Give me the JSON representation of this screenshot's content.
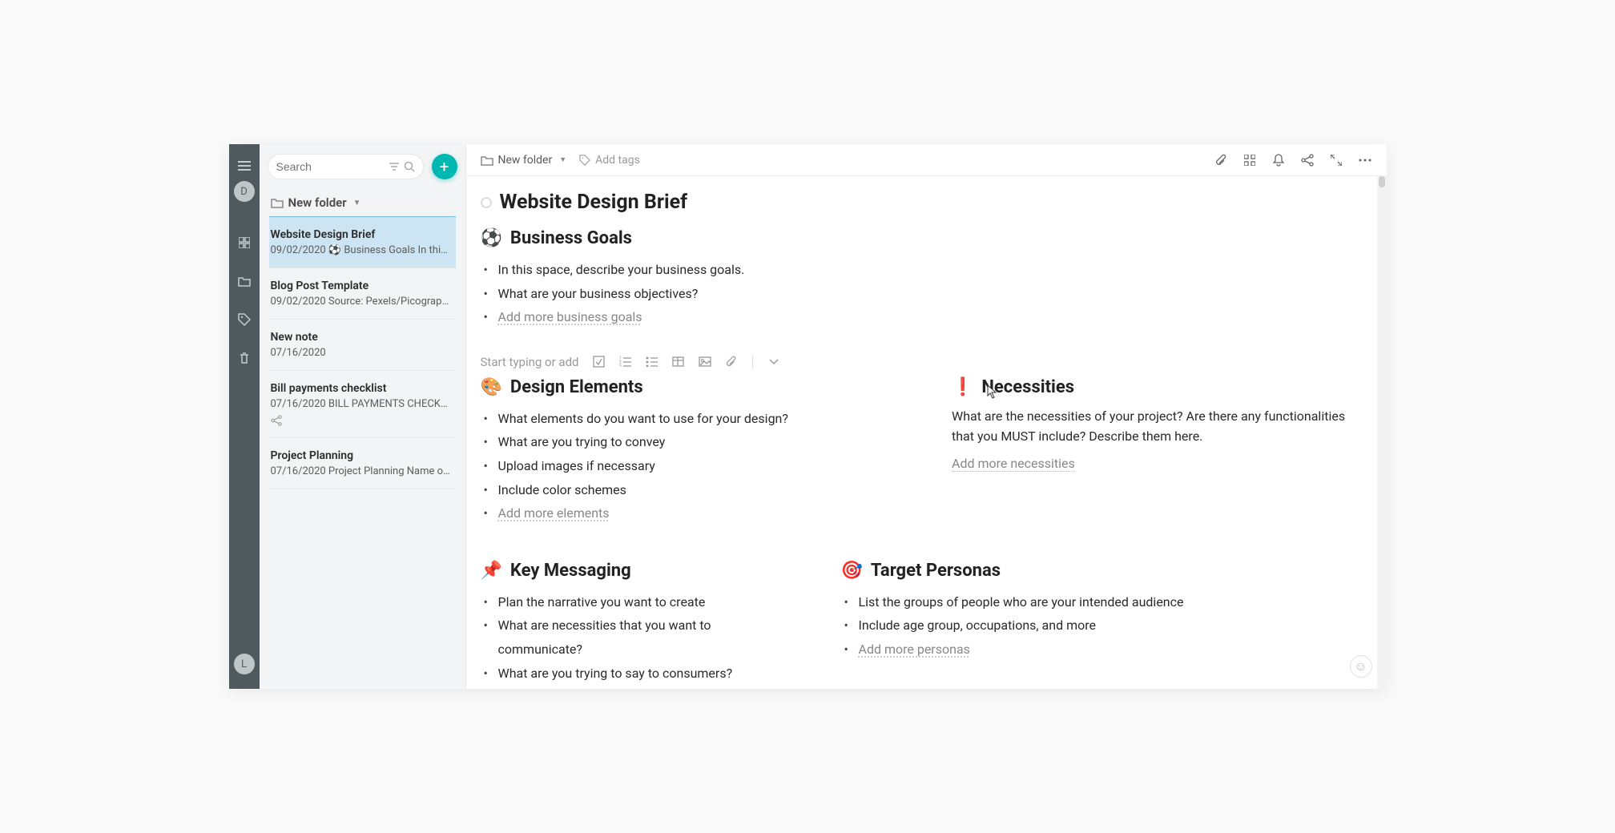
{
  "sidebar": {
    "avatar_top": "D",
    "avatar_bottom": "L"
  },
  "listPanel": {
    "search_placeholder": "Search",
    "folder_label": "New folder",
    "notes": [
      {
        "title": "Website Design Brief",
        "date": "09/02/2020",
        "preview": "⚽ Business Goals In this s...",
        "selected": true
      },
      {
        "title": "Blog Post Template",
        "date": "09/02/2020",
        "preview": "Source: Pexels/Picography ..."
      },
      {
        "title": "New note",
        "date": "07/16/2020",
        "preview": ""
      },
      {
        "title": "Bill payments checklist",
        "date": "07/16/2020",
        "preview": "BILL PAYMENTS CHECKLIS...",
        "shared": true
      },
      {
        "title": "Project Planning",
        "date": "07/16/2020",
        "preview": "Project Planning Name of ..."
      }
    ]
  },
  "header": {
    "crumb": "New folder",
    "add_tags": "Add tags"
  },
  "document": {
    "title": "Website Design Brief",
    "sections": {
      "business": {
        "emoji": "⚽",
        "title": "Business Goals",
        "items": [
          "In this space, describe your business goals.",
          "What are your business objectives?"
        ],
        "placeholder": "Add more business goals"
      },
      "design": {
        "emoji": "🎨",
        "title": "Design Elements",
        "items": [
          "What elements do you want to use for your design?",
          "What are you trying to convey",
          "Upload images if necessary",
          "Include color schemes"
        ],
        "placeholder": "Add more elements"
      },
      "necessities": {
        "emoji": "❗",
        "title": "Necessities",
        "para": "What are the necessities of your project? Are there any functionalities that you MUST include? Describe them here.",
        "placeholder": "Add more necessities"
      },
      "messaging": {
        "emoji": "📌",
        "title": "Key Messaging",
        "items": [
          "Plan the narrative you want to create",
          "What are necessities that you want to communicate?",
          "What are you trying to say to consumers?"
        ]
      },
      "personas": {
        "emoji": "🎯",
        "title": "Target Personas",
        "items": [
          "List the groups of people who are your intended audience",
          "Include age group, occupations, and more"
        ],
        "placeholder": "Add more personas"
      }
    },
    "insert_toolbar": {
      "label": "Start typing or add"
    }
  }
}
